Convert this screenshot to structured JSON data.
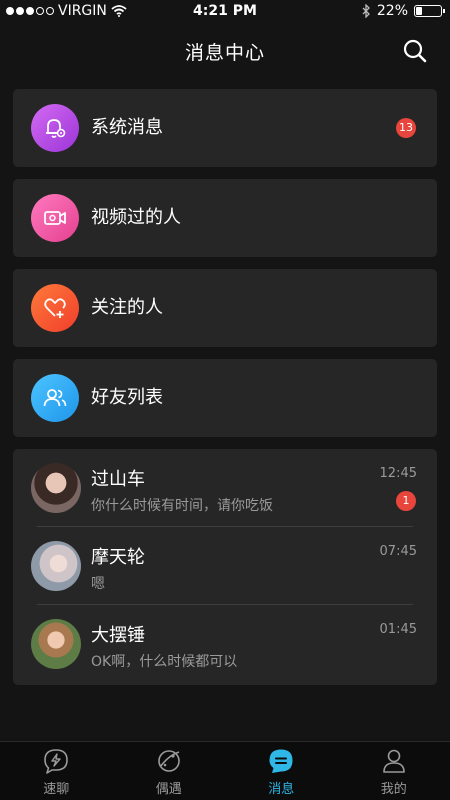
{
  "status_bar": {
    "carrier": "VIRGIN",
    "time": "4:21 PM",
    "battery": "22%",
    "battery_level": 0.22,
    "signal_bars": 3
  },
  "header": {
    "title": "消息中心",
    "search_icon": "search-icon"
  },
  "categories": [
    {
      "label": "系统消息",
      "icon": "bell-gear-icon",
      "color": "#b14ee4",
      "badge": "13"
    },
    {
      "label": "视频过的人",
      "icon": "video-camera-icon",
      "color": "#f05aa6"
    },
    {
      "label": "关注的人",
      "icon": "heart-plus-icon",
      "color": "#f25a34"
    },
    {
      "label": "好友列表",
      "icon": "friends-icon",
      "color": "#2eaaf5"
    }
  ],
  "chats": [
    {
      "name": "过山车",
      "message": "你什么时候有时间，请你吃饭",
      "time": "12:45",
      "badge": "1"
    },
    {
      "name": "摩天轮",
      "message": "嗯",
      "time": "07:45"
    },
    {
      "name": "大摆锤",
      "message": "OK啊，什么时候都可以",
      "time": "01:45"
    }
  ],
  "tabs": [
    {
      "label": "速聊",
      "icon": "lightning-chat-icon",
      "active": false
    },
    {
      "label": "偶遇",
      "icon": "planet-icon",
      "active": false
    },
    {
      "label": "消息",
      "icon": "message-icon",
      "active": true
    },
    {
      "label": "我的",
      "icon": "profile-icon",
      "active": false
    }
  ],
  "colors": {
    "background": "#141414",
    "card": "#262626",
    "badge": "#e8453c",
    "accent": "#2fb7e8"
  }
}
